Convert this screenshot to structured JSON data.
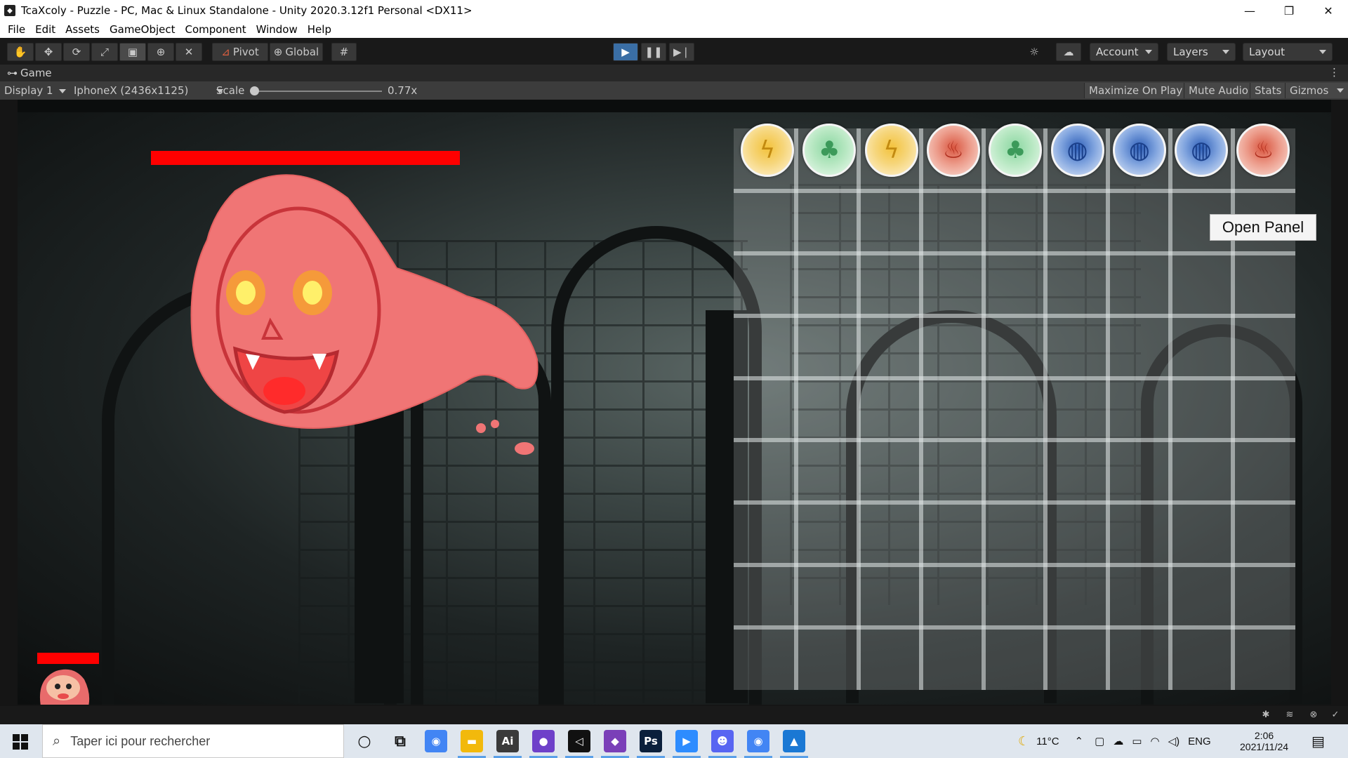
{
  "window": {
    "title": "TcaXcoly - Puzzle - PC, Mac & Linux Standalone - Unity 2020.3.12f1 Personal <DX11>"
  },
  "menu": [
    "File",
    "Edit",
    "Assets",
    "GameObject",
    "Component",
    "Window",
    "Help"
  ],
  "toolbar": {
    "pivot_label": "Pivot",
    "global_label": "Global",
    "account_label": "Account",
    "layers_label": "Layers",
    "layout_label": "Layout"
  },
  "game_tab": {
    "label": "Game",
    "display": "Display 1",
    "resolution": "IphoneX (2436x1125)",
    "scale_label": "Scale",
    "scale_value": "0.77x",
    "scale_fraction": 0.0,
    "maximize_label": "Maximize On Play",
    "mute_label": "Mute Audio",
    "stats_label": "Stats",
    "gizmos_label": "Gizmos"
  },
  "game": {
    "open_panel_label": "Open Panel",
    "enemy_health_fraction": 1.0,
    "player_health_fraction": 1.0,
    "orbs": [
      {
        "element": "lightning",
        "color": "gold"
      },
      {
        "element": "wind",
        "color": "green"
      },
      {
        "element": "lightning",
        "color": "gold"
      },
      {
        "element": "fire",
        "color": "red"
      },
      {
        "element": "wind",
        "color": "green"
      },
      {
        "element": "water",
        "color": "blue"
      },
      {
        "element": "water",
        "color": "blue"
      },
      {
        "element": "water",
        "color": "blue"
      },
      {
        "element": "fire",
        "color": "red"
      }
    ],
    "board_columns": 9,
    "board_rows": 9
  },
  "taskbar": {
    "search_placeholder": "Taper ici pour rechercher",
    "apps": [
      {
        "name": "cortana-icon",
        "glyph": "○"
      },
      {
        "name": "task-view-icon",
        "glyph": "⧉"
      },
      {
        "name": "chrome-icon",
        "glyph": "◉"
      },
      {
        "name": "file-explorer-icon",
        "glyph": "▬"
      },
      {
        "name": "illustrator-icon",
        "glyph": "Ai"
      },
      {
        "name": "github-icon",
        "glyph": "●"
      },
      {
        "name": "unity-icon",
        "glyph": "◁"
      },
      {
        "name": "visual-studio-icon",
        "glyph": "◆"
      },
      {
        "name": "photoshop-icon",
        "glyph": "Ps"
      },
      {
        "name": "zoom-icon",
        "glyph": "▶"
      },
      {
        "name": "discord-icon",
        "glyph": "☻"
      },
      {
        "name": "chrome-profile-icon",
        "glyph": "◉"
      },
      {
        "name": "photos-icon",
        "glyph": "▲"
      }
    ],
    "weather": "11°C",
    "language": "ENG",
    "time": "2:06",
    "date": "2021/11/24"
  },
  "colors": {
    "hp_bar": "#ff0000",
    "play_active": "#3a6ea5"
  }
}
